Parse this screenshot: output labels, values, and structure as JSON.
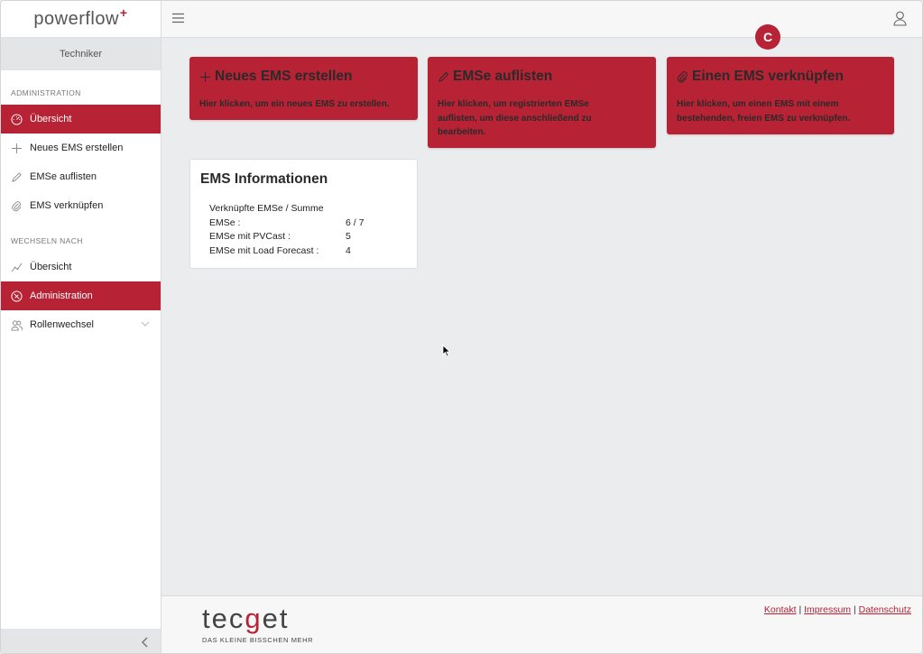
{
  "brand": {
    "name": "powerflow",
    "plus": "+"
  },
  "sidebar": {
    "role": "Techniker",
    "section_admin": "ADMINISTRATION",
    "admin_items": [
      {
        "label": "Übersicht",
        "icon": "dashboard-icon",
        "active": true
      },
      {
        "label": "Neues EMS erstellen",
        "icon": "plus-icon",
        "active": false
      },
      {
        "label": "EMSe auflisten",
        "icon": "pencil-icon",
        "active": false
      },
      {
        "label": "EMS verknüpfen",
        "icon": "paperclip-icon",
        "active": false
      }
    ],
    "section_switch": "WECHSELN NACH",
    "switch_items": [
      {
        "label": "Übersicht",
        "icon": "chart-line-icon",
        "active": false
      },
      {
        "label": "Administration",
        "icon": "compass-icon",
        "active": true
      },
      {
        "label": "Rollenwechsel",
        "icon": "users-icon",
        "active": false
      }
    ]
  },
  "topbar": {
    "badge": "C"
  },
  "cards": [
    {
      "title": "Neues EMS erstellen",
      "icon": "plus-icon",
      "desc": [
        "Hier klicken, um ein neues EMS zu erstellen."
      ]
    },
    {
      "title": "EMSe auflisten",
      "icon": "pencil-icon",
      "desc": [
        "Hier klicken, um registrierten EMSe",
        "auflisten, um diese anschließend zu",
        "bearbeiten."
      ]
    },
    {
      "title": "Einen EMS verknüpfen",
      "icon": "paperclip-icon",
      "desc": [
        "Hier klicken, um einen EMS mit einem",
        "bestehenden, freien EMS zu verknüpfen."
      ]
    }
  ],
  "info": {
    "title": "EMS Informationen",
    "header": "Verknüpfte EMSe / Summe",
    "rows": [
      {
        "key": "EMSe :",
        "value": "6 / 7"
      },
      {
        "key": "EMSe mit PVCast :",
        "value": "5"
      },
      {
        "key": "EMSe mit Load Forecast :",
        "value": "4"
      }
    ]
  },
  "footer": {
    "logo_pre": "tec",
    "logo_g": "g",
    "logo_post": "et",
    "tagline": "DAS KLEINE BISSCHEN MEHR",
    "links": [
      "Kontakt",
      "Impressum",
      "Datenschutz"
    ],
    "separator": "|"
  },
  "colors": {
    "accent": "#b72235",
    "background": "#ebecee"
  }
}
